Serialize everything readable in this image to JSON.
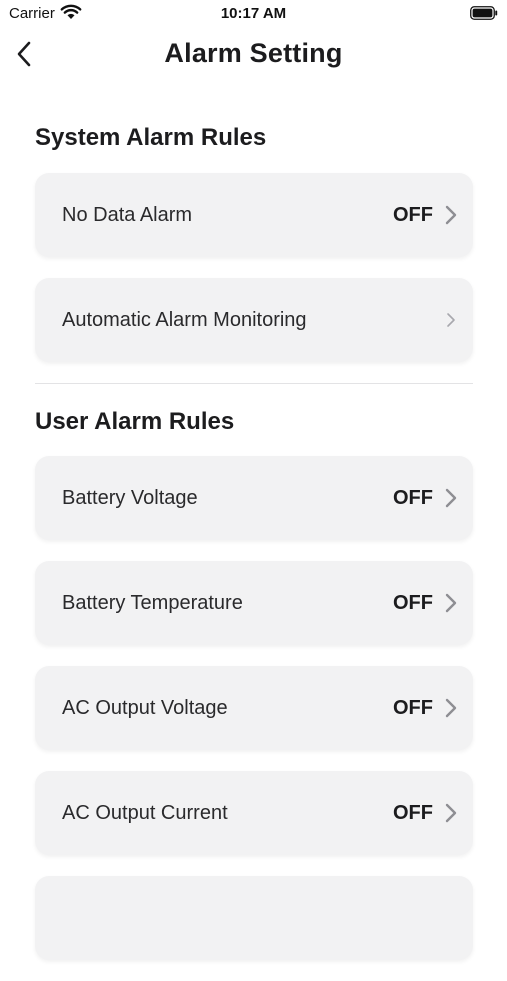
{
  "status_bar": {
    "carrier": "Carrier",
    "time": "10:17 AM"
  },
  "nav": {
    "title": "Alarm Setting"
  },
  "sections": {
    "system": {
      "title": "System Alarm Rules",
      "items": [
        {
          "label": "No Data Alarm",
          "status": "OFF"
        },
        {
          "label": "Automatic Alarm Monitoring",
          "status": ""
        }
      ]
    },
    "user": {
      "title": "User Alarm Rules",
      "items": [
        {
          "label": "Battery Voltage",
          "status": "OFF"
        },
        {
          "label": "Battery Temperature",
          "status": "OFF"
        },
        {
          "label": "AC Output Voltage",
          "status": "OFF"
        },
        {
          "label": "AC Output Current",
          "status": "OFF"
        }
      ]
    }
  },
  "colors": {
    "card_bg": "#f2f2f3",
    "chevron": "#8e8e93",
    "chevron_light": "#c7c7cc"
  }
}
